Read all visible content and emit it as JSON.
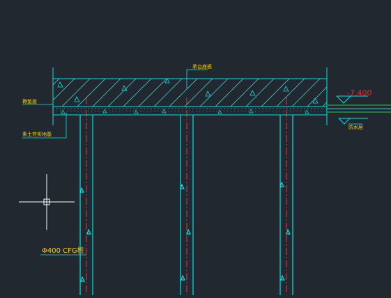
{
  "colors": {
    "background": "#212830",
    "structure": "#00e5e5",
    "annotation": "#ffd000",
    "elevation": "#ff2020",
    "ground_line": "#2ecc40",
    "crosshair": "#ffffff"
  },
  "annotations": {
    "cushion_label": "褥垫层",
    "slab_label": "承台底板",
    "waterproof_label": "防水层",
    "cushion_base_label": "素土夯实地基",
    "pile_label": "Φ400 CFG桩",
    "elevation_value": "-7.400"
  }
}
